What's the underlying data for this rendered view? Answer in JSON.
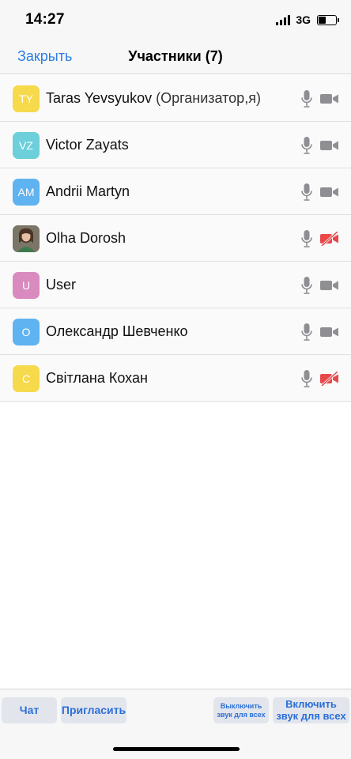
{
  "status_bar": {
    "time": "14:27",
    "network": "3G"
  },
  "nav": {
    "close_label": "Закрыть",
    "title": "Участники (7)"
  },
  "participants": [
    {
      "initials": "TY",
      "color": "#f7d94c",
      "name": "Taras Yevsyukov",
      "suffix": " (Организатор,я)",
      "video_off": false,
      "photo": false
    },
    {
      "initials": "VZ",
      "color": "#6ccfd9",
      "name": "Victor Zayats",
      "suffix": "",
      "video_off": false,
      "photo": false
    },
    {
      "initials": "AM",
      "color": "#5fb3f0",
      "name": "Andrii Martyn",
      "suffix": "",
      "video_off": false,
      "photo": false
    },
    {
      "initials": "",
      "color": "#6d6a5e",
      "name": "Olha Dorosh",
      "suffix": "",
      "video_off": true,
      "photo": true
    },
    {
      "initials": "U",
      "color": "#d98bbf",
      "name": "User",
      "suffix": "",
      "video_off": false,
      "photo": false
    },
    {
      "initials": "O",
      "color": "#5fb3f0",
      "name": "Олександр Шевченко",
      "suffix": "",
      "video_off": false,
      "photo": false
    },
    {
      "initials": "С",
      "color": "#f7d94c",
      "name": "Світлана Кохан",
      "suffix": "",
      "video_off": true,
      "photo": false
    }
  ],
  "toolbar": {
    "chat_label": "Чат",
    "invite_label": "Пригласить",
    "mute_all_label": "Выключить звук для всех",
    "unmute_all_label": "Включить звук для всех"
  },
  "colors": {
    "accent": "#2b7de9",
    "icon_gray": "#8e8e93",
    "video_off_red": "#e9474a"
  }
}
